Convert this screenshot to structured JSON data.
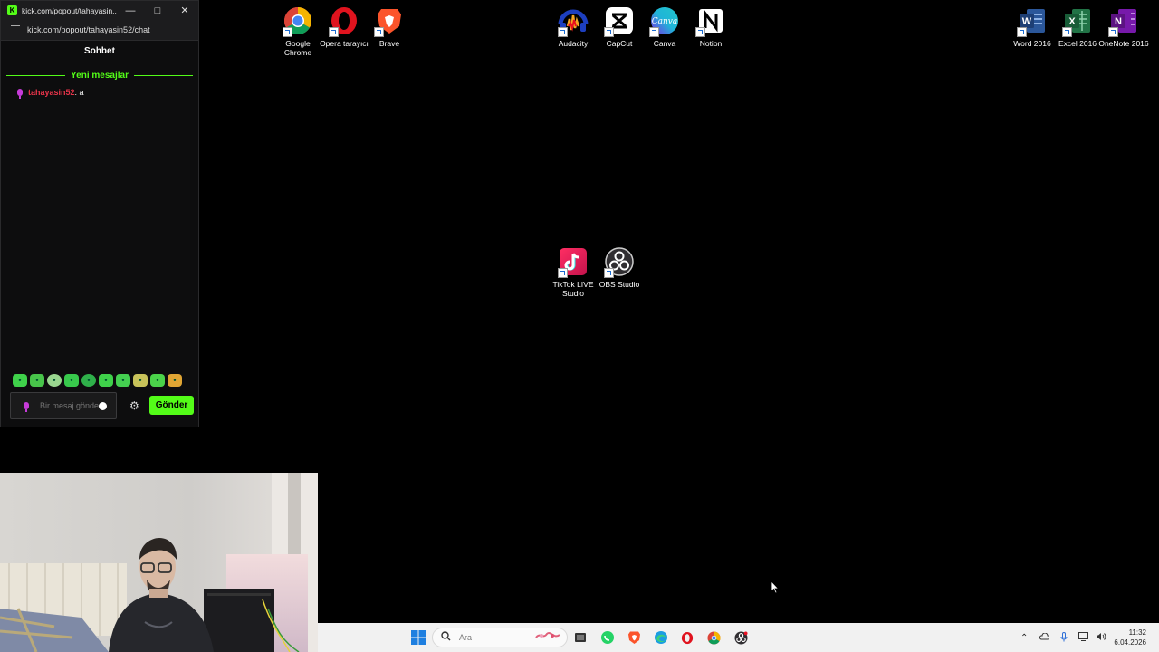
{
  "chat_window": {
    "title": "kick.com/popout/tahayasin...",
    "url": "kick.com/popout/tahayasin52/chat",
    "header": "Sohbet",
    "new_messages_label": "Yeni mesajlar",
    "messages": [
      {
        "user": "tahayasin52",
        "separator": ": ",
        "text": "a"
      }
    ],
    "input_placeholder": "Bir mesaj gönderin",
    "send_label": "Gönder",
    "accent_color": "#53fc18"
  },
  "desktop": {
    "icons": [
      {
        "label": "Google Chrome",
        "icon": "chrome-icon"
      },
      {
        "label": "Opera tarayıcı",
        "icon": "opera-icon"
      },
      {
        "label": "Brave",
        "icon": "brave-icon"
      },
      {
        "label": "Audacity",
        "icon": "audacity-icon"
      },
      {
        "label": "CapCut",
        "icon": "capcut-icon"
      },
      {
        "label": "Canva",
        "icon": "canva-icon"
      },
      {
        "label": "Notion",
        "icon": "notion-icon"
      },
      {
        "label": "Word 2016",
        "icon": "word-icon"
      },
      {
        "label": "Excel 2016",
        "icon": "excel-icon"
      },
      {
        "label": "OneNote 2016",
        "icon": "onenote-icon"
      },
      {
        "label": "TikTok LIVE Studio",
        "icon": "tiktok-live-icon"
      },
      {
        "label": "OBS Studio",
        "icon": "obs-icon"
      }
    ]
  },
  "taskbar": {
    "search_placeholder": "Ara",
    "clock_time": "11:32",
    "clock_date": "6.04.2026"
  }
}
